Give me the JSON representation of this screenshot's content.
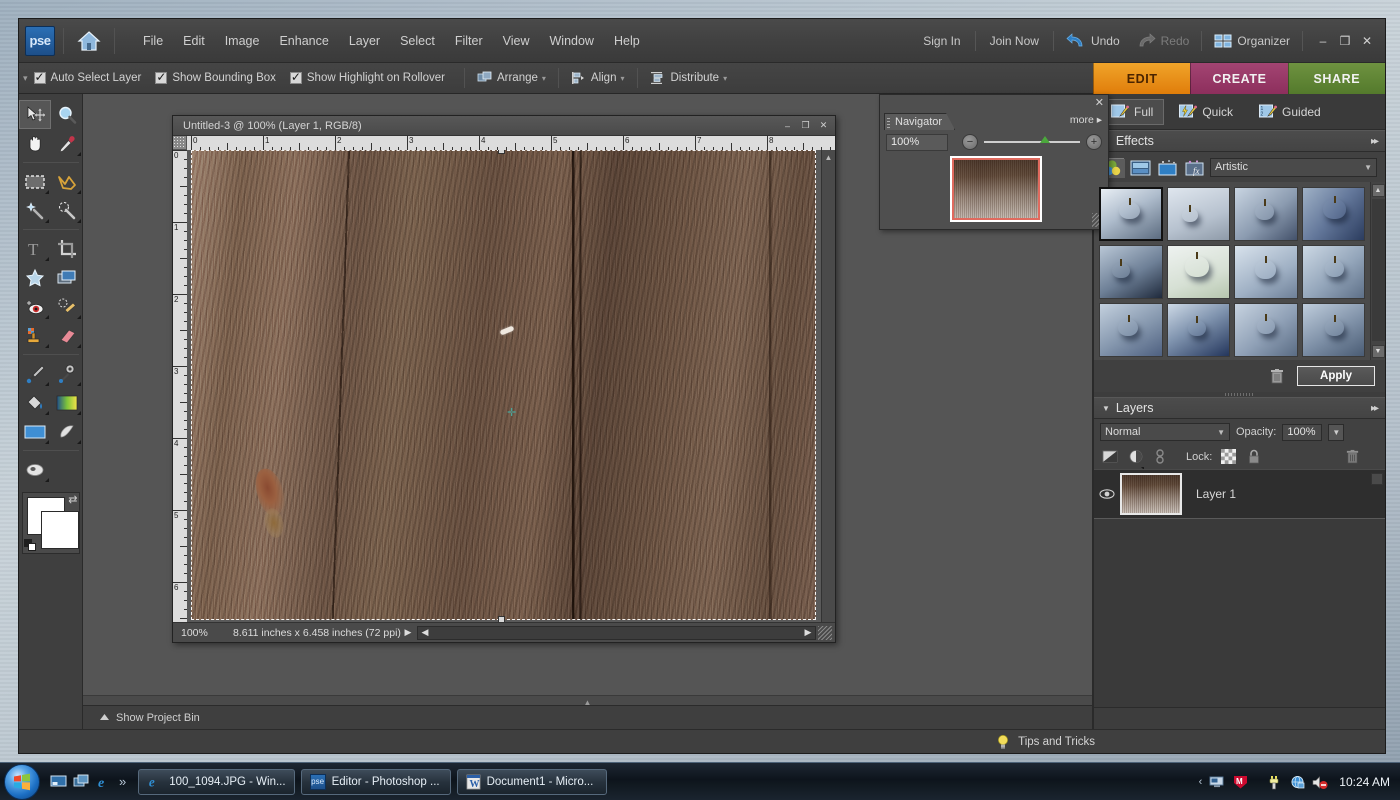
{
  "app": {
    "logo_text": "pse",
    "menu": [
      "File",
      "Edit",
      "Image",
      "Enhance",
      "Layer",
      "Select",
      "Filter",
      "View",
      "Window",
      "Help"
    ],
    "sign_in": "Sign In",
    "join_now": "Join Now",
    "undo": "Undo",
    "redo": "Redo",
    "organizer": "Organizer",
    "minimize": "–",
    "maximize": "❒",
    "close": "✕"
  },
  "options_bar": {
    "checkboxes": [
      {
        "label": "Auto Select Layer",
        "checked": true
      },
      {
        "label": "Show Bounding Box",
        "checked": true
      },
      {
        "label": "Show Highlight on Rollover",
        "checked": true
      }
    ],
    "buttons": [
      {
        "label": "Arrange",
        "icon": "arrange-icon"
      },
      {
        "label": "Align",
        "icon": "align-icon"
      },
      {
        "label": "Distribute",
        "icon": "distribute-icon"
      }
    ]
  },
  "mode_tabs": [
    {
      "label": "EDIT",
      "color": "#e07d0a",
      "active": true
    },
    {
      "label": "CREATE",
      "color": "#8d2f5d",
      "active": false
    },
    {
      "label": "SHARE",
      "color": "#547a2c",
      "active": false
    }
  ],
  "edit_modes": [
    {
      "label": "Full",
      "icon": "full-edit-icon",
      "selected": true
    },
    {
      "label": "Quick",
      "icon": "quick-edit-icon",
      "selected": false
    },
    {
      "label": "Guided",
      "icon": "guided-edit-icon",
      "selected": false
    }
  ],
  "toolbox": {
    "tools": [
      {
        "name": "move-tool",
        "active": true
      },
      {
        "name": "zoom-tool",
        "active": false
      },
      {
        "name": "hand-tool",
        "active": false
      },
      {
        "name": "eyedropper-tool",
        "active": false
      },
      {
        "name": "rectangular-marquee-tool",
        "active": false
      },
      {
        "name": "lasso-tool",
        "active": false
      },
      {
        "name": "magic-wand-tool",
        "active": false
      },
      {
        "name": "quick-selection-tool",
        "active": false
      },
      {
        "name": "type-tool",
        "active": false
      },
      {
        "name": "crop-tool",
        "active": false
      },
      {
        "name": "cookie-cutter-tool",
        "active": false
      },
      {
        "name": "straighten-tool",
        "active": false
      },
      {
        "name": "red-eye-removal-tool",
        "active": false
      },
      {
        "name": "healing-brush-tool",
        "active": false
      },
      {
        "name": "clone-stamp-tool",
        "active": false
      },
      {
        "name": "eraser-tool",
        "active": false
      },
      {
        "name": "brush-tool",
        "active": false
      },
      {
        "name": "smart-brush-tool",
        "active": false
      },
      {
        "name": "paint-bucket-tool",
        "active": false
      },
      {
        "name": "gradient-tool",
        "active": false
      },
      {
        "name": "shape-tool",
        "active": false
      },
      {
        "name": "blur-tool",
        "active": false
      },
      {
        "name": "sponge-tool",
        "active": false
      }
    ],
    "foreground_color": "#ffffff",
    "background_color": "#ffffff"
  },
  "document": {
    "title": "Untitled-3 @ 100% (Layer 1, RGB/8)",
    "zoom": "100%",
    "dimensions": "8.611 inches x 6.458 inches (72 ppi)",
    "h_ruler_labels": [
      "0",
      "1",
      "2",
      "3",
      "4",
      "5",
      "6",
      "7",
      "8"
    ],
    "v_ruler_labels": [
      "0",
      "1",
      "2",
      "3",
      "4",
      "5",
      "6"
    ],
    "minimize": "–",
    "maximize": "❒",
    "close": "✕"
  },
  "navigator": {
    "tab_label": "Navigator",
    "more_label": "more ▸",
    "zoom_value": "100%",
    "close": "✕",
    "zoom_out": "−",
    "zoom_in": "+"
  },
  "effects_panel": {
    "title": "Effects",
    "more": "▸▸",
    "category": "Artistic",
    "icons": [
      "filters-icon",
      "layer-styles-icon",
      "photo-effects-icon",
      "show-all-fx-icon"
    ],
    "apply_label": "Apply",
    "trash_name": "delete-effect-icon",
    "thumb_count": 14,
    "selected_index": 0
  },
  "layers_panel": {
    "title": "Layers",
    "more": "▸▸",
    "blend_mode": "Normal",
    "opacity_label": "Opacity:",
    "opacity_value": "100%",
    "lock_label": "Lock:",
    "layers": [
      {
        "name": "Layer 1",
        "visible": true,
        "selected": true
      }
    ]
  },
  "status_bar": {
    "project_bin": "Show Project Bin",
    "tips": "Tips and Tricks"
  },
  "taskbar": {
    "start_name": "start-orb",
    "quick_launch": [
      "show-desktop-icon",
      "switch-windows-icon",
      "internet-explorer-icon"
    ],
    "overflow": "»",
    "windows": [
      {
        "label": "100_1094.JPG - Win...",
        "icon": "internet-explorer-icon"
      },
      {
        "label": "Editor - Photoshop ...",
        "icon": "photoshop-elements-icon"
      },
      {
        "label": "Document1 - Micro...",
        "icon": "word-icon"
      }
    ],
    "tray_chevron": "‹",
    "tray_icons": [
      "network-monitor-icon",
      "mcafee-icon",
      "power-icon",
      "network-icon",
      "volume-muted-icon"
    ],
    "clock": "10:24 AM"
  }
}
